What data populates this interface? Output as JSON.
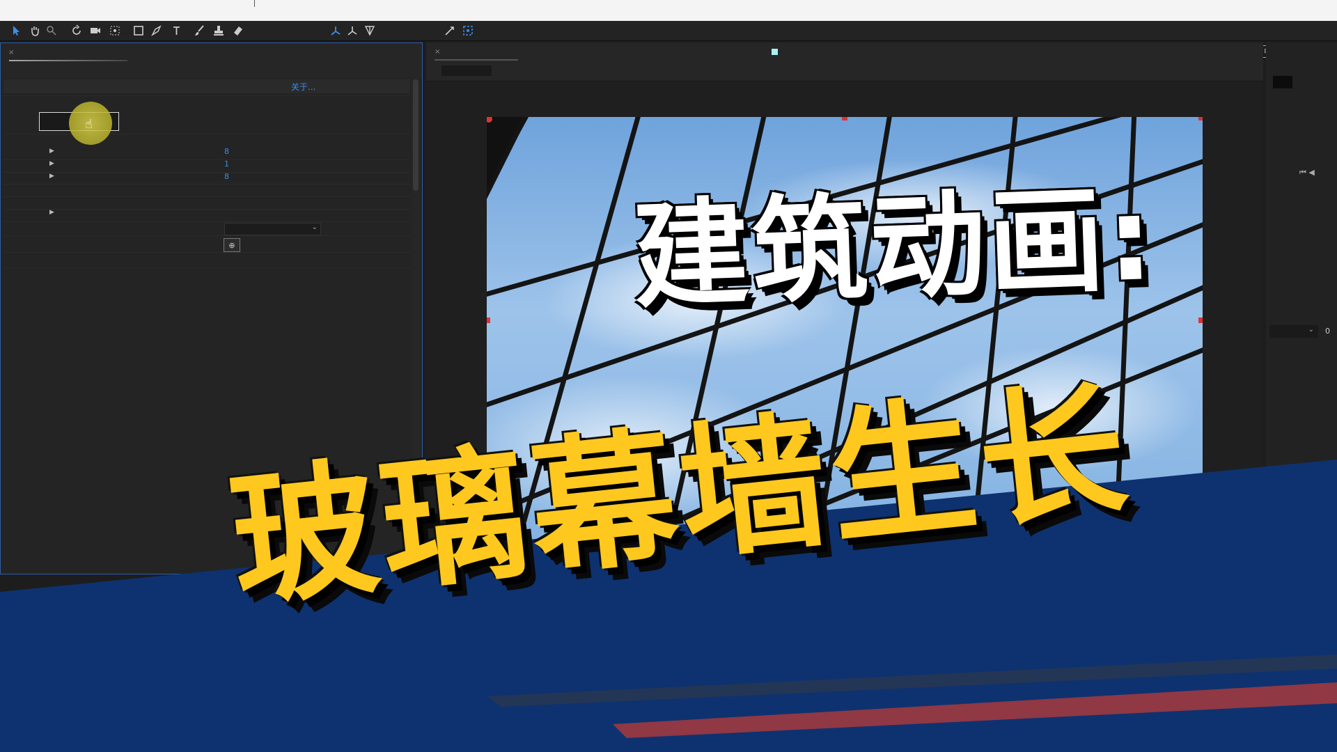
{
  "effects_panel": {
    "about_link": "关于...",
    "params": [
      {
        "value": "8"
      },
      {
        "value": "1"
      },
      {
        "value": "8"
      }
    ]
  },
  "right_panel": {
    "numeric_field": "0"
  },
  "banner": {
    "line1": "建筑动画:",
    "line2": "玻璃幕墙生长",
    "line1_color": "#ffffff",
    "line2_color": "#ffc81e",
    "band_color": "#0e3270"
  },
  "colors": {
    "selection_accent": "#2c5ea8",
    "link_blue": "#3b8eea",
    "handle_red": "#dd3333",
    "cursor_highlight": "#d8d24e"
  },
  "toolbar_icons": [
    "selection-tool-icon",
    "hand-tool-icon",
    "zoom-tool-icon",
    "rotate-tool-icon",
    "camera-tool-icon",
    "pan-behind-tool-icon",
    "rectangle-tool-icon",
    "pen-tool-icon",
    "text-tool-icon",
    "brush-tool-icon",
    "clone-stamp-tool-icon",
    "eraser-tool-icon",
    "local-axis-icon",
    "world-axis-icon",
    "view-axis-icon",
    "snapping-icon",
    "snap-options-icon",
    "workspace-icon"
  ]
}
